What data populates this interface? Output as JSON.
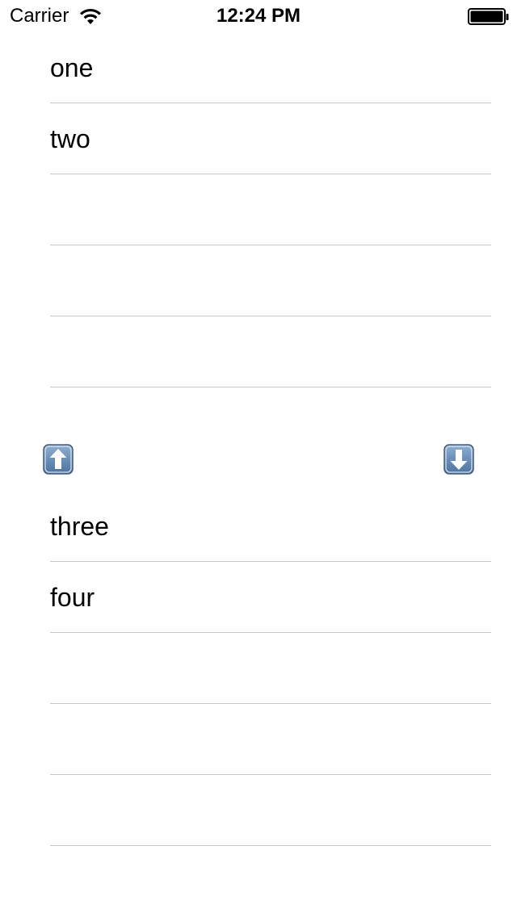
{
  "status_bar": {
    "carrier": "Carrier",
    "time": "12:24 PM",
    "wifi_icon": "wifi-icon",
    "battery_icon": "battery-icon"
  },
  "top_list": {
    "rows": [
      "one",
      "two",
      "",
      "",
      ""
    ]
  },
  "bottom_list": {
    "rows": [
      "three",
      "four",
      "",
      "",
      ""
    ]
  },
  "controls": {
    "up_icon": "arrow-up-icon",
    "down_icon": "arrow-down-icon",
    "button_color": "#5b80a8"
  }
}
